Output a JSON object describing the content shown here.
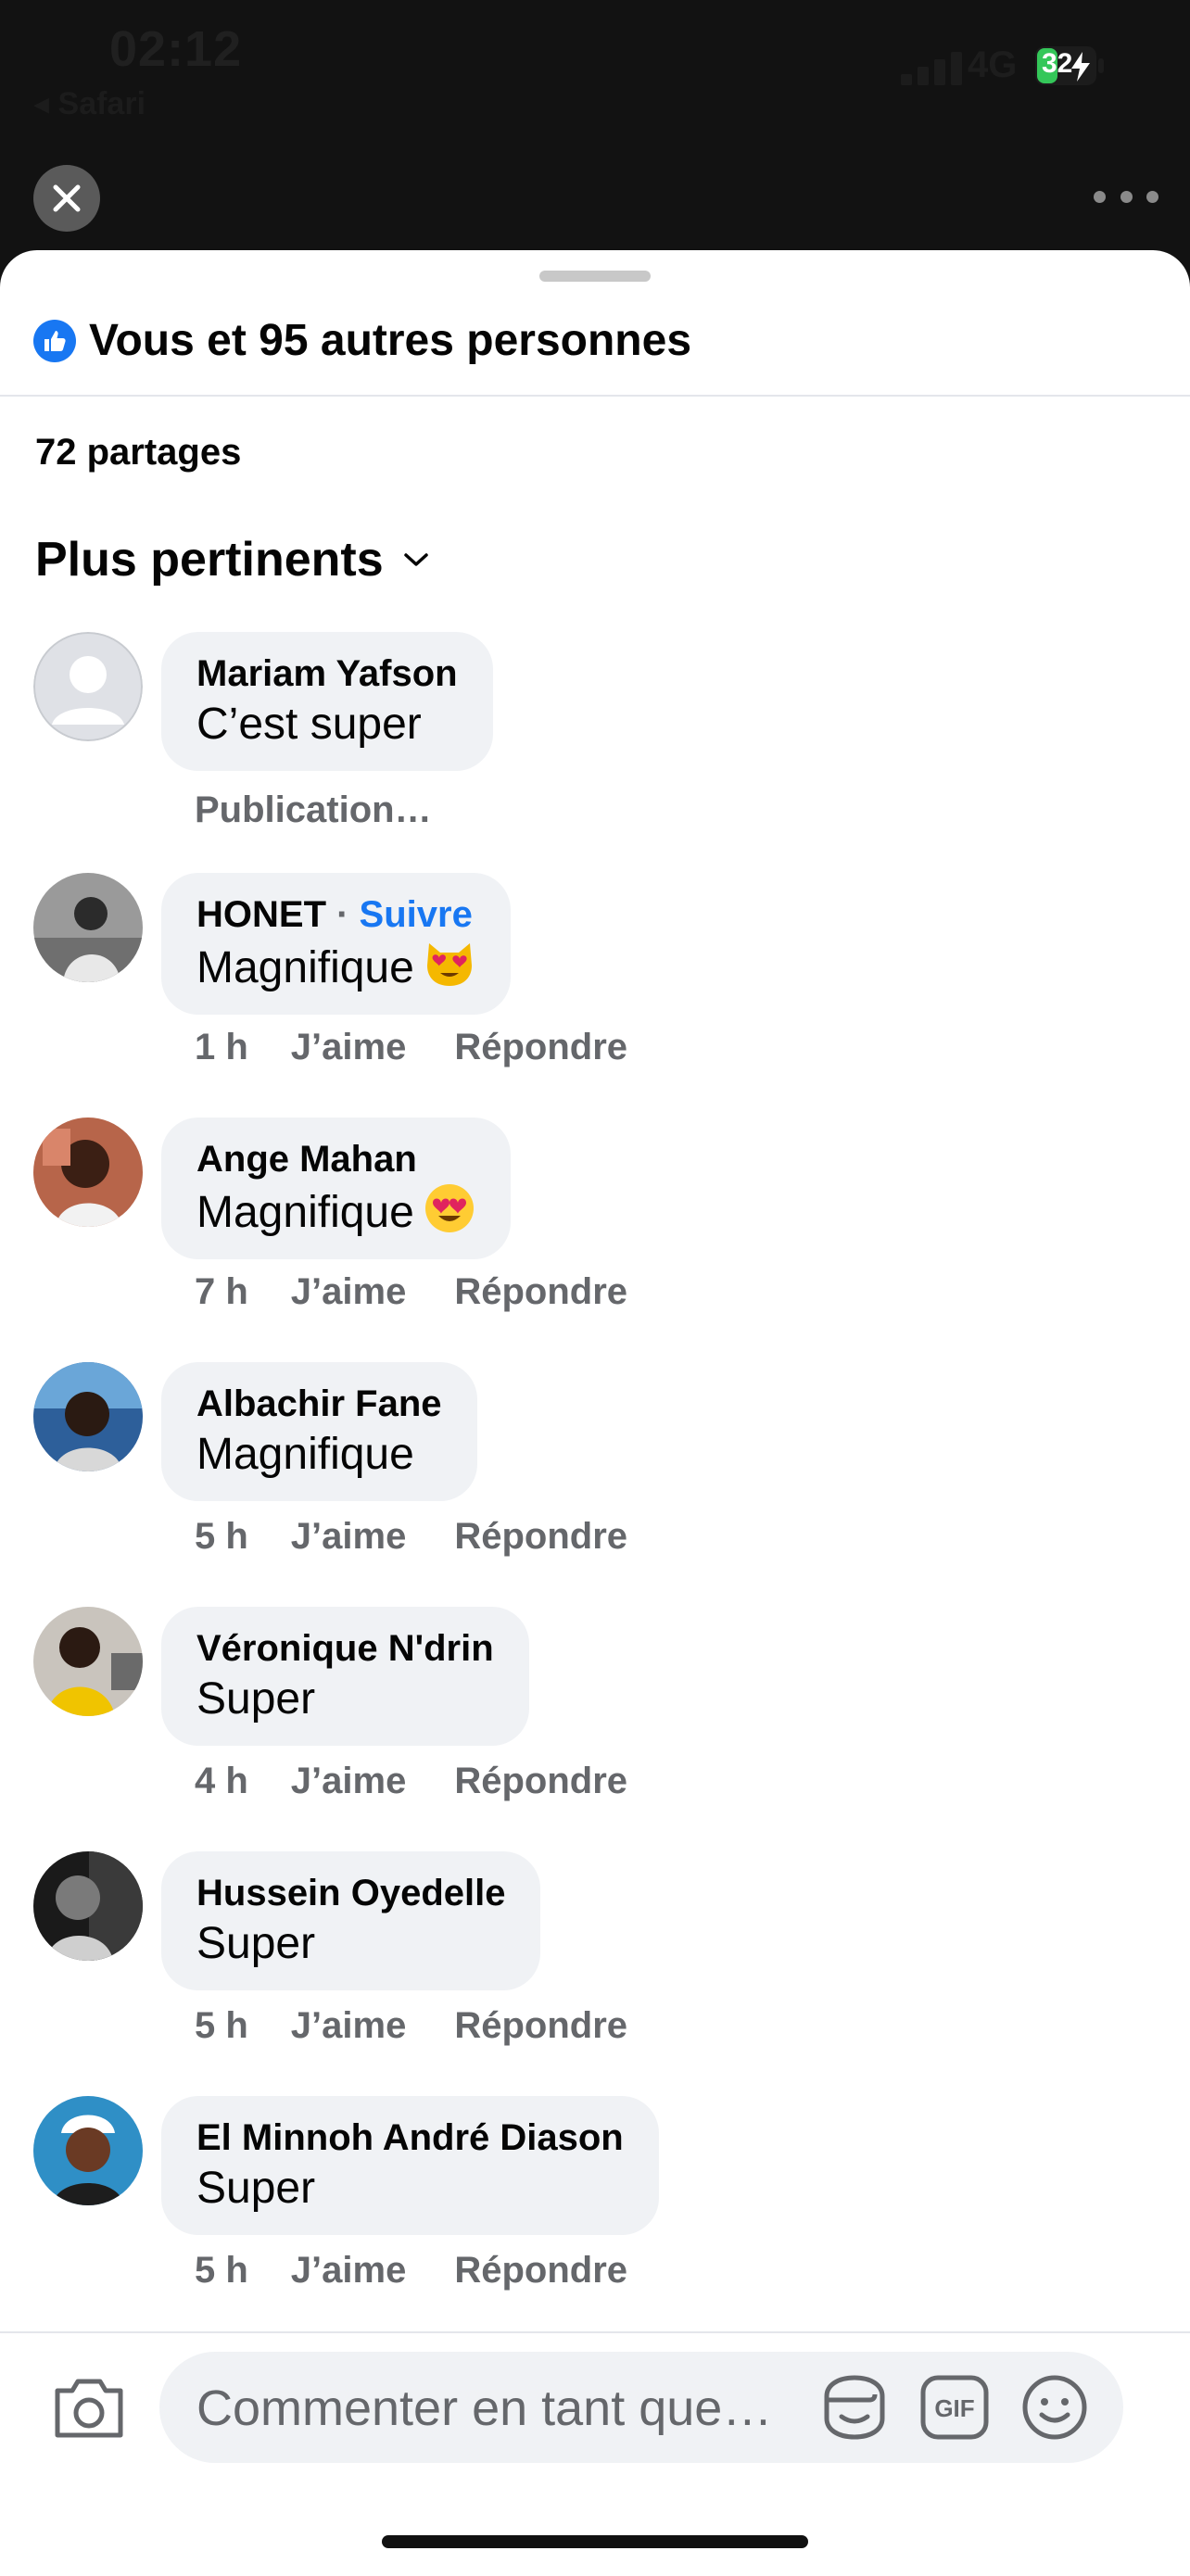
{
  "status_bar": {
    "time": "02:12",
    "back_app": "◂ Safari",
    "network": "4G",
    "battery": "32"
  },
  "header": {
    "reactions_text": "Vous et 95 autres personnes",
    "shares_text": "72 partages",
    "sort_label": "Plus pertinents"
  },
  "comments": [
    {
      "name": "Mariam Yafson",
      "text": "C’est super",
      "meta": "Publication…"
    },
    {
      "name": "HONET",
      "follow": "Suivre",
      "separator": " · ",
      "text": "Magnifique",
      "emoji": "heart-eyes-cat",
      "time": "1 h",
      "like": "J’aime",
      "reply": "Répondre"
    },
    {
      "name": "Ange Mahan",
      "text": "Magnifique",
      "emoji": "heart-eyes",
      "time": "7 h",
      "like": "J’aime",
      "reply": "Répondre"
    },
    {
      "name": "Albachir Fane",
      "text": "Magnifique",
      "time": "5 h",
      "like": "J’aime",
      "reply": "Répondre"
    },
    {
      "name": "Véronique N'drin",
      "text": "Super",
      "time": "4 h",
      "like": "J’aime",
      "reply": "Répondre"
    },
    {
      "name": "Hussein Oyedelle",
      "text": "Super",
      "time": "5 h",
      "like": "J’aime",
      "reply": "Répondre"
    },
    {
      "name": "El Minnoh André Diason",
      "text": "Super",
      "time": "5 h",
      "like": "J’aime",
      "reply": "Répondre"
    }
  ],
  "composer": {
    "placeholder": "Commenter en tant que…"
  },
  "icons": [
    "close-icon",
    "more-icon",
    "like-icon",
    "chevron-down-icon",
    "camera-icon",
    "sticker-icon",
    "gif-icon",
    "emoji-icon"
  ],
  "colors": {
    "accent": "#1877f2",
    "bubble": "#f0f2f5",
    "meta_text": "#65676b",
    "backdrop": "#121212"
  }
}
